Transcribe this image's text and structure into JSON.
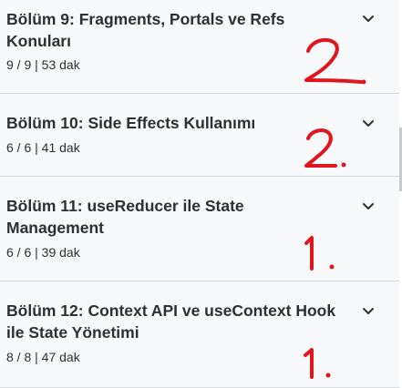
{
  "sections": [
    {
      "title": "Bölüm 9: Fragments, Portals ve Refs Konuları",
      "progress": "9 / 9",
      "separator": "|",
      "duration": "53 dak",
      "expand_icon": "chevron-down-icon",
      "handwritten_note": "2."
    },
    {
      "title": "Bölüm 10: Side Effects Kullanımı",
      "progress": "6 / 6",
      "separator": "|",
      "duration": "41 dak",
      "expand_icon": "chevron-down-icon",
      "handwritten_note": "2."
    },
    {
      "title": "Bölüm 11: useReducer ile State Management",
      "progress": "6 / 6",
      "separator": "|",
      "duration": "39 dak",
      "expand_icon": "chevron-down-icon",
      "handwritten_note": "1."
    },
    {
      "title": "Bölüm 12: Context API ve useContext Hook ile State Yönetimi",
      "progress": "8 / 8",
      "separator": "|",
      "duration": "47 dak",
      "expand_icon": "chevron-down-icon",
      "handwritten_note": "1."
    }
  ],
  "colors": {
    "panel_background": "#f7f9fa",
    "divider": "#d1d7dc",
    "text": "#2d2f31",
    "handwriting": "#e0161f"
  }
}
